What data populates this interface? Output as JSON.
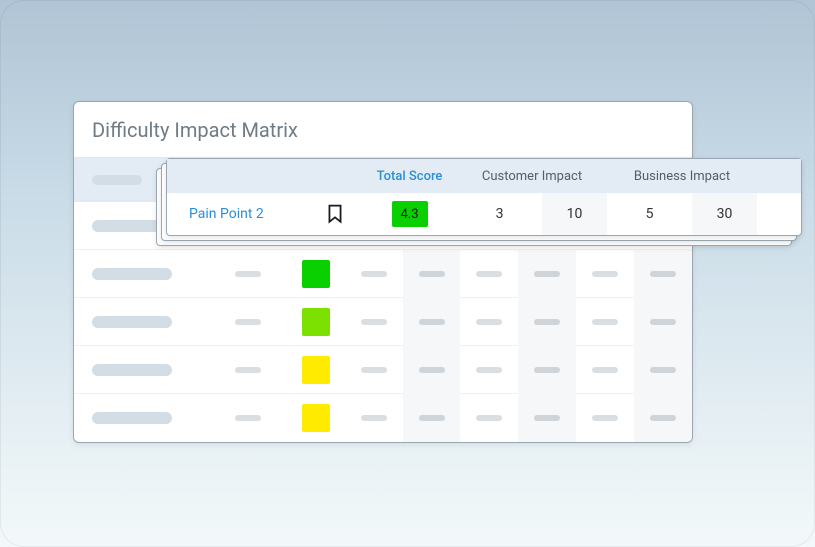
{
  "panel": {
    "title": "Difficulty Impact Matrix"
  },
  "columns": {
    "total_score": "Total Score",
    "customer_impact": "Customer Impact",
    "business_impact": "Business Impact"
  },
  "highlight_row": {
    "name": "Pain Point 2",
    "icon": "bookmark-icon",
    "total_score": "4.3",
    "total_score_color": "#0ACF00",
    "customer_impact_value": "3",
    "customer_impact_weight": "10",
    "business_impact_value": "5",
    "business_impact_weight": "30"
  },
  "placeholder_rows": [
    {
      "score_color": "#0ACF00"
    },
    {
      "score_color": "#7CE100"
    },
    {
      "score_color": "#FFEB00"
    },
    {
      "score_color": "#FFEB00"
    }
  ]
}
